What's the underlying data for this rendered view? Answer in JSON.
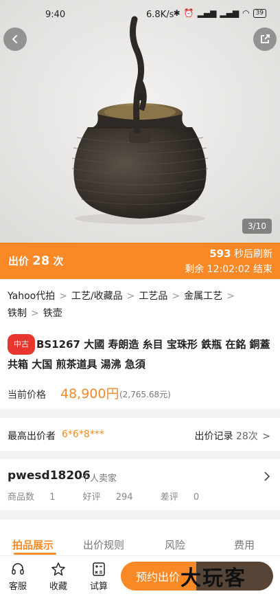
{
  "status_bar": {
    "time": "9:40",
    "net_speed": "6.8K/s",
    "battery": "39"
  },
  "gallery": {
    "counter": "3/10"
  },
  "bid_bar": {
    "bids_label": "出价",
    "bids_count": "28",
    "bids_unit": "次",
    "refresh_seconds": "593",
    "refresh_text": "秒后刷新",
    "remaining_label": "剩余",
    "remaining_time": "12:02:02",
    "ends_text": "结束"
  },
  "breadcrumb": [
    "Yahoo代拍",
    "工艺/收藏品",
    "工艺品",
    "金属工艺",
    "铁制",
    "铁壶"
  ],
  "item": {
    "condition_tag": "中古",
    "title": "BS1267 大國 寿朗造 糸目 宝珠形 鉄瓶 在銘 銅蓋 共箱 大国 煎茶道具 湯沸 急須",
    "price_label": "当前价格",
    "price": "48,900円",
    "price_cny": "(2,765.68元)"
  },
  "highest_bidder": {
    "label": "最高出价者",
    "name": "6*6*8***",
    "records_label": "出价记录",
    "records_count": "28次"
  },
  "seller": {
    "name": "pwesd18206",
    "type": "个人卖家",
    "items_label": "商品数",
    "items_count": "1",
    "good_label": "好评",
    "good_count": "294",
    "bad_label": "差评",
    "bad_count": "0"
  },
  "tabs": [
    "拍品展示",
    "出价规则",
    "风险",
    "费用"
  ],
  "bottom_bar": {
    "service": "客服",
    "favorite": "收藏",
    "calculator": "试算",
    "cta": "预约出价",
    "watermark": "大玩客"
  },
  "colors": {
    "accent": "#f98826",
    "price": "#f28b28",
    "tag_red": "#e8352e"
  }
}
